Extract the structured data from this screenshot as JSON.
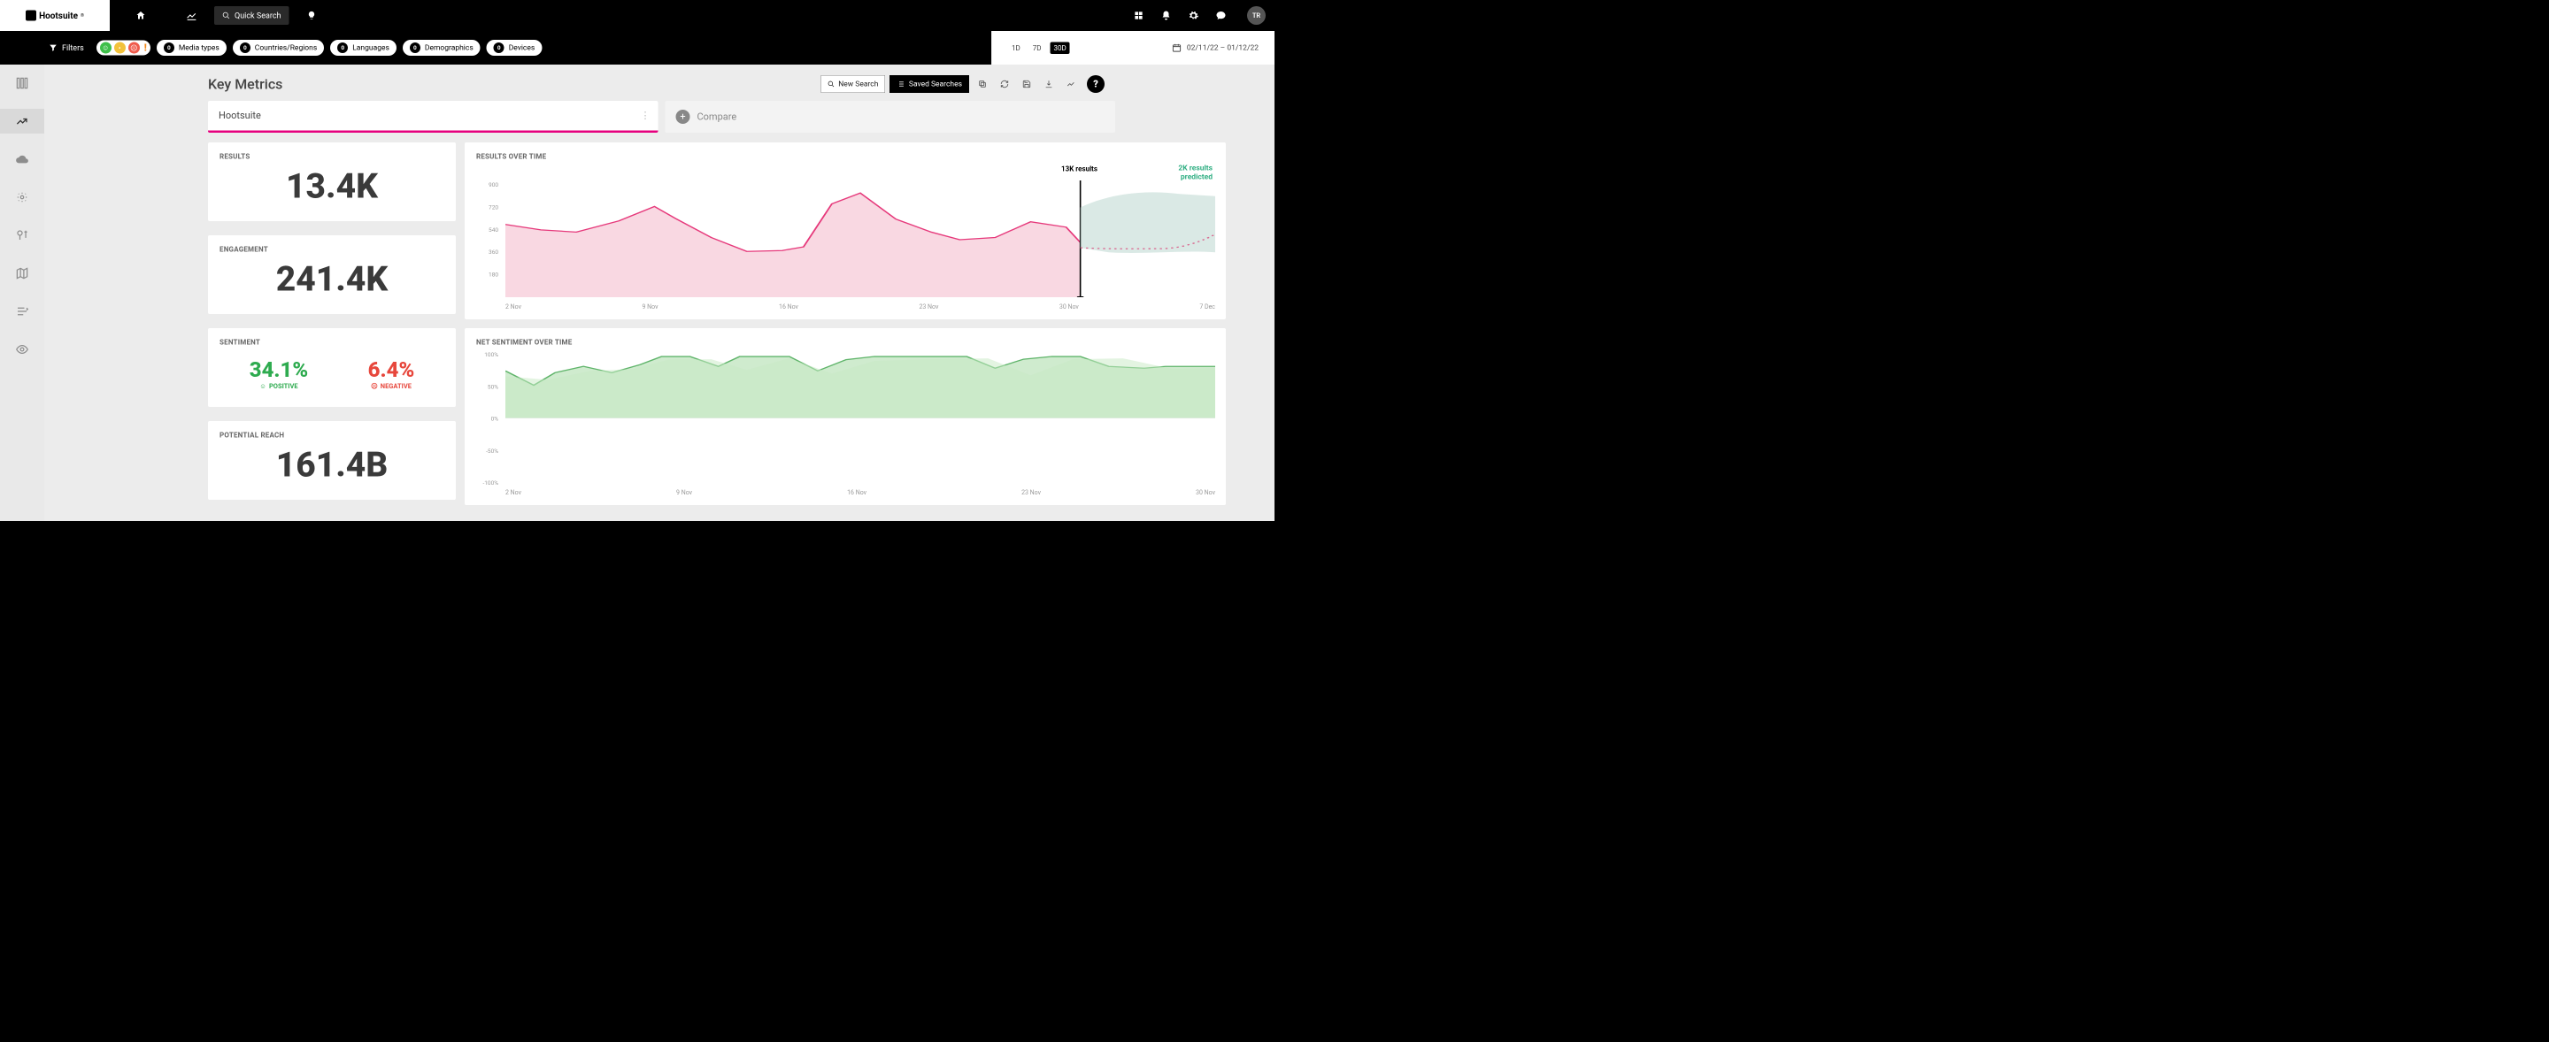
{
  "brand": "Hootsuite",
  "topbar": {
    "quick_search": "Quick Search",
    "avatar": "TR"
  },
  "filterbar": {
    "label": "Filters",
    "pills": [
      {
        "count": "0",
        "label": "Media types"
      },
      {
        "count": "0",
        "label": "Countries/Regions"
      },
      {
        "count": "0",
        "label": "Languages"
      },
      {
        "count": "0",
        "label": "Demographics"
      },
      {
        "count": "0",
        "label": "Devices"
      }
    ]
  },
  "date_range": {
    "options": [
      "1D",
      "7D",
      "30D"
    ],
    "selected": "30D",
    "range": "02/11/22 – 01/12/22"
  },
  "page_title": "Key Metrics",
  "actions": {
    "new_search": "New Search",
    "saved_searches": "Saved Searches"
  },
  "tabs": {
    "term": "Hootsuite",
    "compare": "Compare"
  },
  "kpis": {
    "results": {
      "label": "RESULTS",
      "value": "13.4K"
    },
    "engagement": {
      "label": "ENGAGEMENT",
      "value": "241.4K"
    },
    "sentiment": {
      "label": "SENTIMENT",
      "pos_pct": "34.1%",
      "pos_lbl": "POSITIVE",
      "neg_pct": "6.4%",
      "neg_lbl": "NEGATIVE"
    },
    "reach": {
      "label": "POTENTIAL REACH",
      "value": "161.4B"
    }
  },
  "results_chart": {
    "title": "RESULTS OVER TIME",
    "annot_left": "13K results",
    "annot_right": "2K results\npredicted",
    "x_labels": [
      "2 Nov",
      "9 Nov",
      "16 Nov",
      "23 Nov",
      "30 Nov",
      "7 Dec"
    ],
    "y_ticks": [
      "180",
      "360",
      "540",
      "720",
      "900"
    ]
  },
  "sentiment_chart": {
    "title": "NET SENTIMENT OVER TIME",
    "x_labels": [
      "2 Nov",
      "9 Nov",
      "16 Nov",
      "23 Nov",
      "30 Nov"
    ],
    "y_ticks": [
      "-100%",
      "-50%",
      "0%",
      "50%",
      "100%"
    ]
  },
  "chart_data": [
    {
      "type": "area",
      "title": "RESULTS OVER TIME",
      "xlabel": "",
      "ylabel": "results",
      "ylim": [
        0,
        900
      ],
      "x": [
        "2 Nov",
        "4 Nov",
        "6 Nov",
        "8 Nov",
        "9 Nov",
        "11 Nov",
        "13 Nov",
        "15 Nov",
        "16 Nov",
        "17 Nov",
        "19 Nov",
        "21 Nov",
        "23 Nov",
        "25 Nov",
        "27 Nov",
        "29 Nov",
        "30 Nov"
      ],
      "series": [
        {
          "name": "results",
          "values": [
            560,
            520,
            500,
            620,
            700,
            460,
            350,
            380,
            720,
            800,
            600,
            500,
            440,
            460,
            580,
            540,
            420
          ]
        },
        {
          "name": "predicted",
          "x": [
            "30 Nov",
            "2 Dec",
            "4 Dec",
            "7 Dec"
          ],
          "values": [
            380,
            370,
            370,
            440
          ]
        }
      ]
    },
    {
      "type": "area",
      "title": "NET SENTIMENT OVER TIME",
      "xlabel": "",
      "ylabel": "net sentiment",
      "ylim": [
        -100,
        100
      ],
      "x": [
        "2 Nov",
        "4 Nov",
        "6 Nov",
        "8 Nov",
        "9 Nov",
        "11 Nov",
        "13 Nov",
        "15 Nov",
        "16 Nov",
        "18 Nov",
        "20 Nov",
        "22 Nov",
        "23 Nov",
        "25 Nov",
        "27 Nov",
        "29 Nov",
        "30 Nov"
      ],
      "series": [
        {
          "name": "net_sentiment",
          "values": [
            72,
            50,
            70,
            82,
            85,
            95,
            80,
            95,
            95,
            72,
            90,
            95,
            95,
            95,
            78,
            90,
            78
          ]
        }
      ]
    }
  ]
}
